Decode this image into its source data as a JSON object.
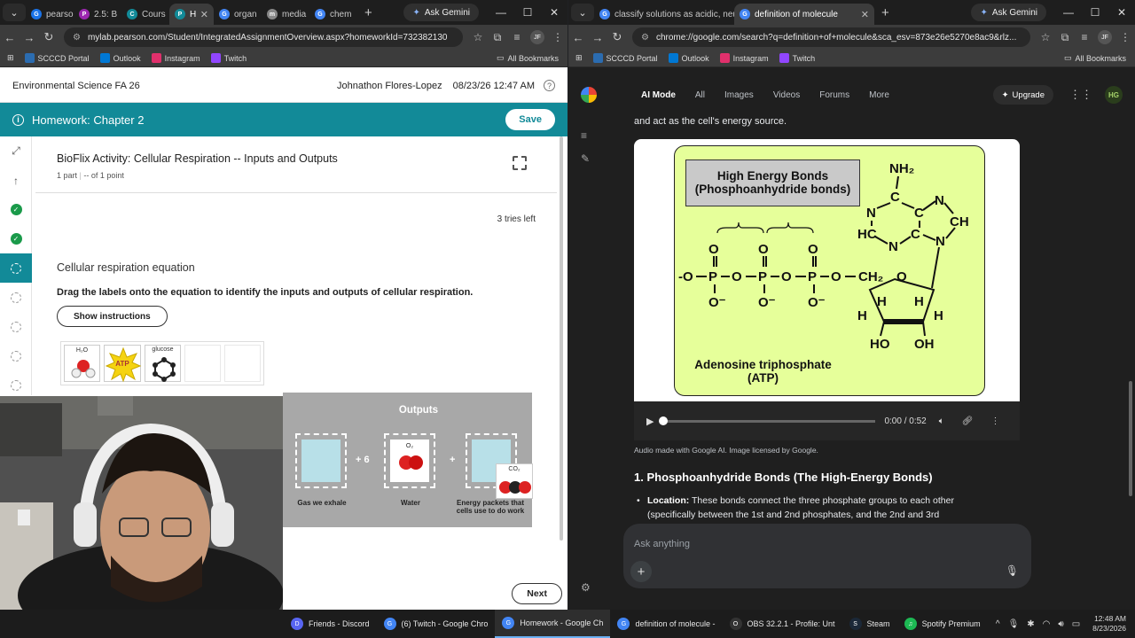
{
  "left_browser": {
    "tabs": [
      {
        "label": "pearso",
        "color": "#1a73e8",
        "glyph": "G"
      },
      {
        "label": "2.5: B",
        "color": "#9c27b0",
        "glyph": "P"
      },
      {
        "label": "Cours",
        "color": "#128a98",
        "glyph": "C"
      },
      {
        "label": "H",
        "color": "#128a98",
        "glyph": "P",
        "active": true
      },
      {
        "label": "organ",
        "color": "#4285f4",
        "glyph": "G"
      },
      {
        "label": "media",
        "color": "#888888",
        "glyph": "m"
      },
      {
        "label": "chem",
        "color": "#4285f4",
        "glyph": "G"
      }
    ],
    "ask_gemini": "Ask Gemini",
    "url": "mylab.pearson.com/Student/IntegratedAssignmentOverview.aspx?homeworkId=732382130",
    "bookmarks": [
      {
        "label": "SCCCD Portal",
        "color": "#2b6cb0"
      },
      {
        "label": "Outlook",
        "color": "#0078d4"
      },
      {
        "label": "Instagram",
        "color": "#e1306c"
      },
      {
        "label": "Twitch",
        "color": "#9146ff"
      }
    ],
    "all_bookmarks": "All Bookmarks"
  },
  "pearson": {
    "course": "Environmental Science FA 26",
    "user": "Johnathon Flores-Lopez",
    "datetime": "08/23/26 12:47 AM",
    "help": "?",
    "homework_title": "Homework: Chapter 2",
    "save": "Save",
    "activity_title": "BioFlix Activity: Cellular Respiration -- Inputs and Outputs",
    "activity_parts": "1 part",
    "activity_points": "-- of 1 point",
    "tries_left": "3 tries left",
    "part_title": "Cellular respiration equation",
    "instructions": "Drag the labels onto the equation to identify the inputs and outputs of cellular respiration.",
    "show_instructions": "Show instructions",
    "label_bank": [
      {
        "label": "H₂O"
      },
      {
        "label": "ATP"
      },
      {
        "label": "glucose"
      }
    ],
    "outputs_heading": "Outputs",
    "operators": [
      "+ 6",
      "+"
    ],
    "slot_captions": [
      "Gas we exhale",
      "Water",
      "Energy packets that cells use to do work"
    ],
    "o2_label": "O₂",
    "dragging_label": "CO₂",
    "next": "Next"
  },
  "right_browser": {
    "tabs": [
      {
        "label": "classify solutions as acidic, neu",
        "color": "#4285f4",
        "glyph": "G"
      },
      {
        "label": "definition of molecule",
        "color": "#4285f4",
        "glyph": "G",
        "active": true
      }
    ],
    "ask_gemini": "Ask Gemini",
    "url": "chrome://google.com/search?q=definition+of+molecule&sca_esv=873e26e5270e8ac9&rlz...",
    "bookmarks": [
      {
        "label": "SCCCD Portal",
        "color": "#2b6cb0"
      },
      {
        "label": "Outlook",
        "color": "#0078d4"
      },
      {
        "label": "Instagram",
        "color": "#e1306c"
      },
      {
        "label": "Twitch",
        "color": "#9146ff"
      }
    ],
    "all_bookmarks": "All Bookmarks"
  },
  "google": {
    "tabs": [
      "AI Mode",
      "All",
      "Images",
      "Videos",
      "Forums",
      "More"
    ],
    "upgrade": "Upgrade",
    "avatar": "HG",
    "snippet": "and act as the cell's energy source.",
    "figure": {
      "high_energy_bonds": "High Energy Bonds",
      "phosphoanhydride": "(Phosphoanhydride bonds)",
      "name": "Adenosine triphosphate",
      "abbrev": "(ATP)"
    },
    "audio_time": "0:00 / 0:52",
    "audio_credit": "Audio made with Google AI. Image licensed by Google.",
    "section_heading": "1. Phosphoanhydride Bonds (The High-Energy Bonds)",
    "bullet_label": "Location:",
    "bullet_text": " These bonds connect the three phosphate groups to each other (specifically between the 1st and 2nd phosphates, and the 2nd and 3rd",
    "ask_placeholder": "Ask anything"
  },
  "taskbar": {
    "items": [
      {
        "label": "Friends - Discord",
        "color": "#5865f2",
        "glyph": "D"
      },
      {
        "label": "(6) Twitch - Google Chro",
        "color": "#4285f4",
        "glyph": "G"
      },
      {
        "label": "Homework - Google Ch",
        "color": "#4285f4",
        "glyph": "G",
        "active": true
      },
      {
        "label": "definition of molecule -",
        "color": "#4285f4",
        "glyph": "G"
      },
      {
        "label": "OBS 32.2.1 - Profile: Unt",
        "color": "#333333",
        "glyph": "O"
      },
      {
        "label": "Steam",
        "color": "#1b2838",
        "glyph": "S"
      },
      {
        "label": "Spotify Premium",
        "color": "#1db954",
        "glyph": "♫"
      }
    ],
    "time": "12:48 AM",
    "date": "8/23/2026"
  }
}
